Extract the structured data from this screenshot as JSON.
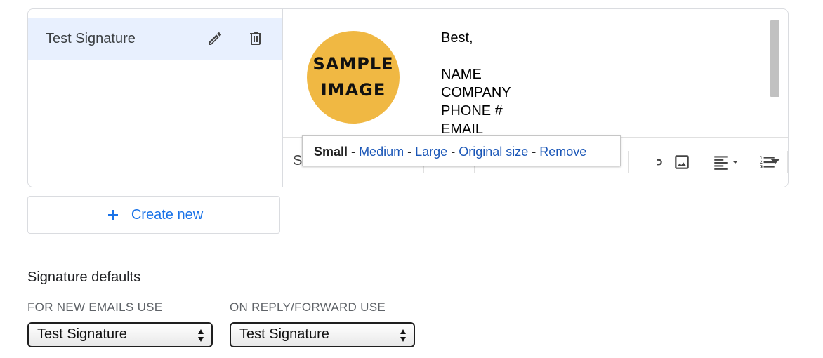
{
  "signatures": [
    {
      "name": "Test Signature"
    }
  ],
  "signature_preview": {
    "image_text_line1": "SAMPLE",
    "image_text_line2": "IMAGE",
    "lines": [
      "Best,",
      "",
      "NAME",
      "COMPANY",
      "PHONE #",
      "EMAIL"
    ]
  },
  "toolbar": {
    "font_partial": "S"
  },
  "image_size_popup": {
    "small": "Small",
    "medium": "Medium",
    "large": "Large",
    "original": "Original size",
    "remove": "Remove",
    "separator": "-"
  },
  "create_new_label": "Create new",
  "defaults": {
    "title": "Signature defaults",
    "new_emails_label": "FOR NEW EMAILS USE",
    "reply_label": "ON REPLY/FORWARD USE",
    "new_emails_value": "Test Signature",
    "reply_value": "Test Signature"
  },
  "colors": {
    "accent": "#1a73e8",
    "selected_bg": "#e8f0fe",
    "image_circle": "#f0b843",
    "link": "#1a56b7"
  }
}
